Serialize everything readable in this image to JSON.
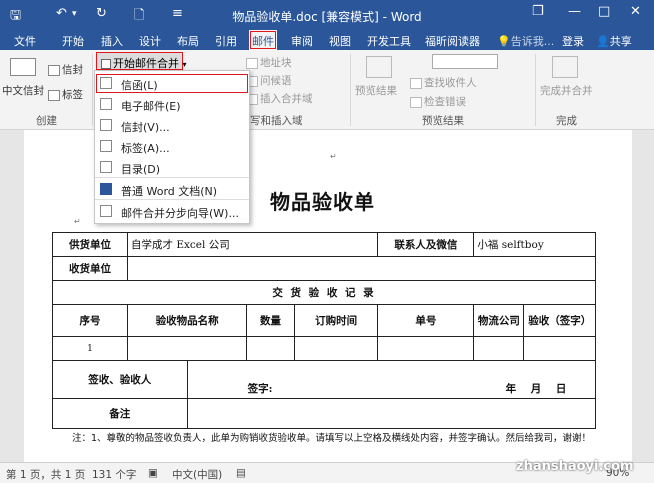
{
  "titlebar": {
    "save": "🖫",
    "undo": "↶",
    "undo_caret": "▾",
    "redo": "↻",
    "preview": "🗋",
    "customize": "≡",
    "title": "物品验收单.doc [兼容模式] - Word",
    "restore": "❐",
    "minimize": "—",
    "maximize": "□",
    "close": "✕"
  },
  "tabs": [
    "文件",
    "开始",
    "插入",
    "设计",
    "布局",
    "引用",
    "邮件",
    "审阅",
    "视图",
    "开发工具",
    "福昕阅读器"
  ],
  "tell_me": "💡告诉我...",
  "login": "登录",
  "share": "共享",
  "ribbon": {
    "envelope": "信封",
    "chinese_envelope": "中文信封",
    "labels": "标签",
    "group_create": "创建",
    "start_merge": "开始邮件合并",
    "address_block": "地址块",
    "greeting_line": "问候语",
    "insert_merge_field": "插入合并域",
    "group_write_insert": "写和插入域",
    "preview_results": "预览结果",
    "find_recipient": "查找收件人",
    "check_errors": "检查错误",
    "group_preview": "预览结果",
    "finish_merge": "完成并合并",
    "group_finish": "完成"
  },
  "menu": [
    {
      "label": "信函(L)",
      "icon": "letter-icon"
    },
    {
      "label": "电子邮件(E)",
      "icon": "email-icon"
    },
    {
      "label": "信封(V)...",
      "icon": "envelope-icon"
    },
    {
      "label": "标签(A)...",
      "icon": "label-icon"
    },
    {
      "label": "目录(D)",
      "icon": "directory-icon"
    },
    {
      "label": "普通 Word 文档(N)",
      "icon": "word-icon"
    },
    {
      "label": "邮件合并分步向导(W)...",
      "icon": "wizard-icon"
    }
  ],
  "document": {
    "title": "物品验收单",
    "row1": {
      "supplier_label": "供货单位",
      "supplier_value": "自学成才 Excel 公司",
      "contact_label": "联系人及微信",
      "contact_value": "小福     selftboy"
    },
    "row2": {
      "receiver_label": "收货单位"
    },
    "section_header": "交 货 验 收 记 录",
    "headers": [
      "序号",
      "验收物品名称",
      "数量",
      "订购时间",
      "单号",
      "物流公司",
      "验收（签字）"
    ],
    "row_index": "1",
    "sign_label": "签收、验收人",
    "sign_text": "签字:",
    "date_text": "年    月    日",
    "remark_label": "备注",
    "note": "注：1、尊敬的物品签收负责人，此单为购销收货验收单。请填写以上空格及横线处内容，并签字确认。然后给我司，谢谢！"
  },
  "status": {
    "page": "第 1 页，共 1 页",
    "words": "131 个字",
    "lang": "中文(中国)",
    "zoom": "90%"
  },
  "watermark": "zhanshaoyi.com"
}
